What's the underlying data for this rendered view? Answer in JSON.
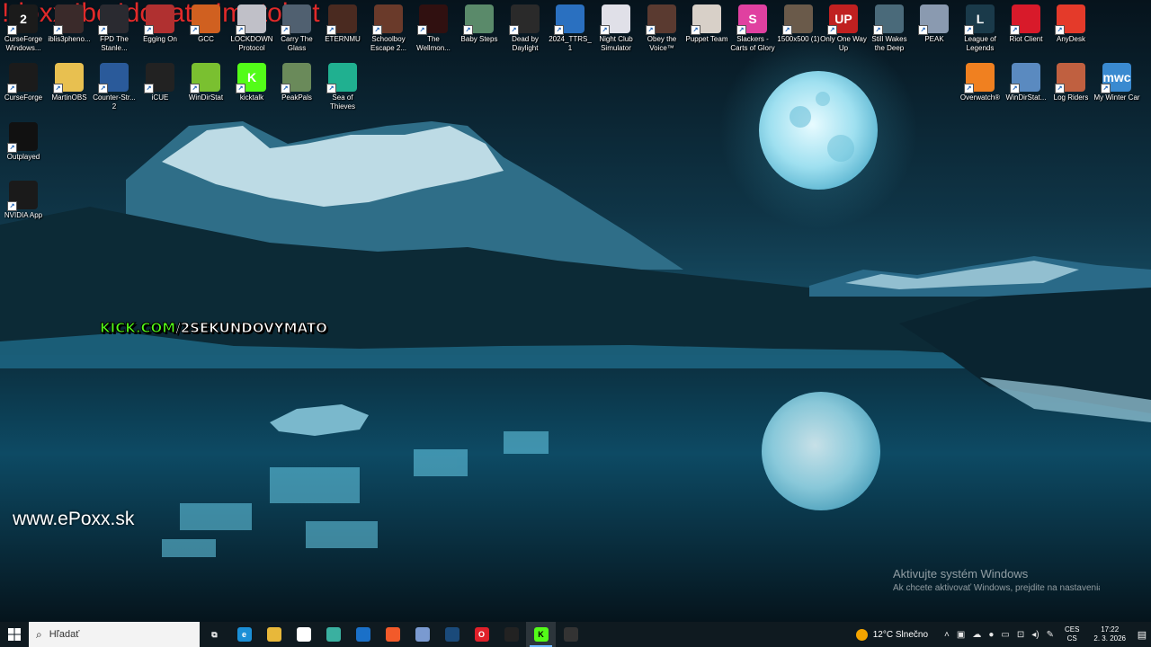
{
  "overlay": {
    "commands": "!doxx !bc !donate !matobot",
    "kick_prefix": "KICK.COM",
    "kick_suffix": "/2SEKUNDOVYMATO",
    "website": "www.ePoxx.sk"
  },
  "activation": {
    "title": "Aktivujte systém Windows",
    "subtitle": "Ak chcete aktivovať Windows, prejdite na nastavenia."
  },
  "desktop_icons": {
    "r1": [
      {
        "label": "CurseForge Windows...",
        "icon": "curseforge-icon",
        "color": "#1b1b1b",
        "glyph": "2"
      },
      {
        "label": "iblis3pheno...",
        "icon": "game-icon",
        "color": "#3a2a2a",
        "glyph": ""
      },
      {
        "label": "FPD The Stanle...",
        "icon": "game-icon",
        "color": "#2a2a30",
        "glyph": ""
      },
      {
        "label": "Egging On",
        "icon": "game-icon",
        "color": "#b03030",
        "glyph": ""
      },
      {
        "label": "GCC",
        "icon": "game-icon",
        "color": "#d06020",
        "glyph": ""
      },
      {
        "label": "LOCKDOWN Protocol",
        "icon": "game-icon",
        "color": "#c0c0c8",
        "glyph": ""
      },
      {
        "label": "Carry The Glass",
        "icon": "game-icon",
        "color": "#506070",
        "glyph": ""
      },
      {
        "label": "ETERNMU",
        "icon": "game-icon",
        "color": "#4a2a20",
        "glyph": ""
      },
      {
        "label": "Schoolboy Escape 2...",
        "icon": "game-icon",
        "color": "#6a3a2a",
        "glyph": ""
      },
      {
        "label": "The Wellmon...",
        "icon": "game-icon",
        "color": "#301010",
        "glyph": ""
      },
      {
        "label": "Baby Steps",
        "icon": "game-icon",
        "color": "#5a8a6a",
        "glyph": ""
      },
      {
        "label": "Dead by Daylight",
        "icon": "dbd-icon",
        "color": "#2a2a2a",
        "glyph": ""
      },
      {
        "label": "2024_TTRS_1",
        "icon": "game-icon",
        "color": "#2a70c0",
        "glyph": ""
      },
      {
        "label": "Night Club Simulator",
        "icon": "game-icon",
        "color": "#e0e0e8",
        "glyph": ""
      },
      {
        "label": "Obey the Voice™",
        "icon": "game-icon",
        "color": "#5a3a30",
        "glyph": ""
      },
      {
        "label": "Puppet Team",
        "icon": "game-icon",
        "color": "#d8d0c8",
        "glyph": ""
      },
      {
        "label": "Slackers - Carts of Glory",
        "icon": "game-icon",
        "color": "#e040a0",
        "glyph": "S"
      },
      {
        "label": "1500x500 (1)",
        "icon": "image-icon",
        "color": "#6a5a4a",
        "glyph": ""
      },
      {
        "label": "Only One Way Up",
        "icon": "game-icon",
        "color": "#c02020",
        "glyph": "UP"
      },
      {
        "label": "Still Wakes the Deep",
        "icon": "game-icon",
        "color": "#4a6a7a",
        "glyph": ""
      },
      {
        "label": "PEAK",
        "icon": "game-icon",
        "color": "#8a9ab0",
        "glyph": ""
      },
      {
        "label": "League of Legends",
        "icon": "lol-icon",
        "color": "#1a3a4a",
        "glyph": "L"
      },
      {
        "label": "Riot Client",
        "icon": "riot-icon",
        "color": "#d81a2a",
        "glyph": ""
      },
      {
        "label": "AnyDesk",
        "icon": "anydesk-icon",
        "color": "#e43a2a",
        "glyph": ""
      }
    ],
    "r2": [
      {
        "label": "CurseForge",
        "icon": "curseforge-icon",
        "color": "#1b1b1b",
        "glyph": ""
      },
      {
        "label": "MartinOBS",
        "icon": "folder-icon",
        "color": "#e8c050",
        "glyph": ""
      },
      {
        "label": "Counter-Str... 2",
        "icon": "cs2-icon",
        "color": "#2a5a9a",
        "glyph": ""
      },
      {
        "label": "iCUE",
        "icon": "icue-icon",
        "color": "#222222",
        "glyph": ""
      },
      {
        "label": "WinDirStat",
        "icon": "windirstat-icon",
        "color": "#7ac030",
        "glyph": ""
      },
      {
        "label": "kicktalk",
        "icon": "kick-icon",
        "color": "#53fc18",
        "glyph": "K"
      },
      {
        "label": "PeakPals",
        "icon": "game-icon",
        "color": "#6a8a5a",
        "glyph": ""
      },
      {
        "label": "Sea of Thieves",
        "icon": "game-icon",
        "color": "#20b090",
        "glyph": ""
      },
      {
        "label": "Overwatch®",
        "icon": "overwatch-icon",
        "color": "#f08020",
        "glyph": ""
      },
      {
        "label": "WinDirStat...",
        "icon": "windirstat-icon",
        "color": "#5a8ac0",
        "glyph": ""
      },
      {
        "label": "Log Riders",
        "icon": "game-icon",
        "color": "#c06040",
        "glyph": ""
      },
      {
        "label": "My Winter Car",
        "icon": "game-icon",
        "color": "#3a8ad0",
        "glyph": "mwc"
      }
    ],
    "col": [
      {
        "label": "Outplayed",
        "icon": "outplayed-icon",
        "color": "#111111",
        "glyph": ""
      },
      {
        "label": "NVIDIA App",
        "icon": "nvidia-icon",
        "color": "#1a1a1a",
        "glyph": ""
      }
    ]
  },
  "taskbar": {
    "search_placeholder": "Hľadať",
    "apps": [
      {
        "name": "task-view",
        "color": "#ffffff",
        "glyph": "⧉"
      },
      {
        "name": "edge",
        "color": "#1b8fd6",
        "glyph": "e"
      },
      {
        "name": "file-explorer",
        "color": "#e8b83a",
        "glyph": ""
      },
      {
        "name": "store",
        "color": "#ffffff",
        "glyph": ""
      },
      {
        "name": "copilot",
        "color": "#3ab0a0",
        "glyph": ""
      },
      {
        "name": "outlook",
        "color": "#1a70c8",
        "glyph": ""
      },
      {
        "name": "brave",
        "color": "#f25a2a",
        "glyph": ""
      },
      {
        "name": "app",
        "color": "#7a9ad0",
        "glyph": ""
      },
      {
        "name": "steam",
        "color": "#1a4a7a",
        "glyph": ""
      },
      {
        "name": "opera",
        "color": "#e0202a",
        "glyph": "O"
      },
      {
        "name": "obs",
        "color": "#222222",
        "glyph": ""
      },
      {
        "name": "kicktalk",
        "color": "#53fc18",
        "glyph": "K"
      },
      {
        "name": "app2",
        "color": "#333333",
        "glyph": ""
      }
    ],
    "weather": "12°C  Slnečno",
    "lang_1": "CES",
    "lang_2": "CS",
    "time": "17:22",
    "date": "2. 3. 2026"
  }
}
